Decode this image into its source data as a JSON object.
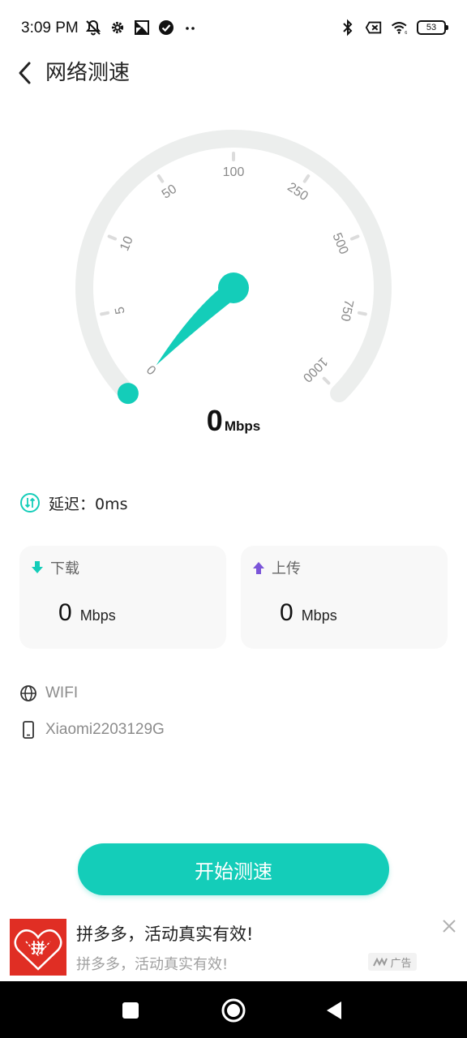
{
  "status_bar": {
    "time": "3:09 PM",
    "battery": "53",
    "left_icons": [
      "dnd-bell-icon",
      "gear-icon",
      "gallery-icon",
      "check-badge-icon",
      "more-dots-icon"
    ],
    "right_icons": [
      "bluetooth-icon",
      "sim-off-icon",
      "wifi-icon",
      "battery-icon"
    ]
  },
  "header": {
    "title": "网络测速",
    "back_icon": "chevron-left-icon"
  },
  "gauge": {
    "ticks": [
      "0",
      "5",
      "10",
      "50",
      "100",
      "250",
      "500",
      "750",
      "1000"
    ],
    "value": "0",
    "unit": "Mbps",
    "colors": {
      "track": "#eceeed",
      "needle": "#14cdb9",
      "tick_label": "#8a8a8a"
    }
  },
  "latency": {
    "label": "延迟：0ms"
  },
  "download": {
    "label": "下载",
    "value": "0",
    "unit": "Mbps",
    "color": "#14cdb9"
  },
  "upload": {
    "label": "上传",
    "value": "0",
    "unit": "Mbps",
    "color": "#7b55d9"
  },
  "network": {
    "type": "WIFI",
    "device": "Xiaomi2203129G"
  },
  "start_button": {
    "label": "开始测速",
    "color": "#14cdb9"
  },
  "ad": {
    "title": "拼多多，活动真实有效!",
    "subtitle": "拼多多，活动真实有效!",
    "tag": "广告",
    "logo_text": "拼",
    "brand_color": "#e02e24"
  },
  "nav": {
    "icons": [
      "recents-icon",
      "home-icon",
      "back-icon"
    ]
  }
}
